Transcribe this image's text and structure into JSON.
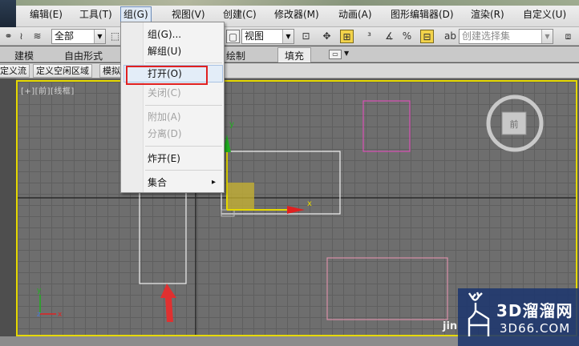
{
  "menubar": {
    "items": [
      {
        "label": "编辑(E)"
      },
      {
        "label": "工具(T)"
      },
      {
        "label": "组(G)"
      },
      {
        "label": "视图(V)"
      },
      {
        "label": "创建(C)"
      },
      {
        "label": "修改器(M)"
      },
      {
        "label": "动画(A)"
      },
      {
        "label": "图形编辑器(D)"
      },
      {
        "label": "渲染(R)"
      },
      {
        "label": "自定义(U)"
      }
    ]
  },
  "toolbar": {
    "selection_filter": "全部",
    "ref_coord": "视图",
    "named_selection_placeholder": "创建选择集"
  },
  "ribbon": {
    "tabs": [
      {
        "label": "建模"
      },
      {
        "label": "自由形式"
      },
      {
        "label": "绘制"
      },
      {
        "label": "填充"
      }
    ]
  },
  "subribbon": {
    "buttons": [
      {
        "label": "定义流"
      },
      {
        "label": "定义空闲区域"
      },
      {
        "label": "模拟"
      }
    ]
  },
  "viewport": {
    "label": "[+][前][线框]",
    "axis_y": "y",
    "axis_x": "x",
    "corner_axis_y": "y",
    "corner_axis_x": "x",
    "corner_axis_z": "z",
    "viewcube_face": "前"
  },
  "group_menu": {
    "items": [
      {
        "label": "组(G)..."
      },
      {
        "label": "解组(U)"
      },
      {
        "label": "打开(O)"
      },
      {
        "label": "关闭(C)"
      },
      {
        "label": "附加(A)"
      },
      {
        "label": "分离(D)"
      },
      {
        "label": "炸开(E)"
      },
      {
        "label": "集合"
      }
    ],
    "submenu_arrow": "▸"
  },
  "watermark": {
    "title": "3D溜溜网",
    "url": "3D66.COM",
    "side_text": "jin"
  },
  "colors": {
    "viewport_border": "#e6d900",
    "highlight_box": "#e02020",
    "axis_x": "#e02020",
    "axis_y": "#20b020",
    "gizmo_plane": "#e6d900"
  }
}
